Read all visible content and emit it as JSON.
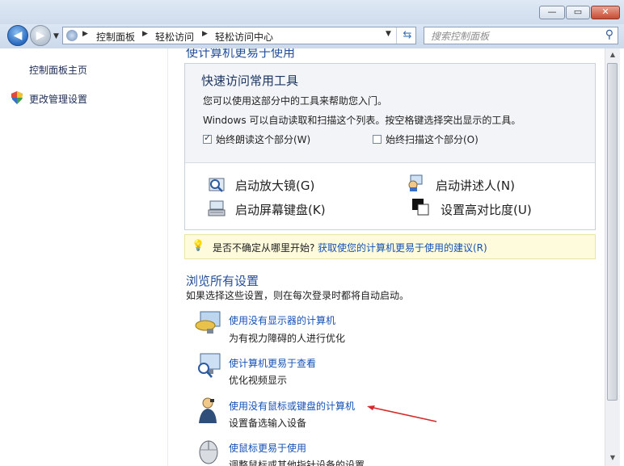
{
  "window_controls": {
    "minimize": "—",
    "maximize": "▭",
    "close": "✕"
  },
  "nav": {
    "breadcrumbs": [
      "控制面板",
      "轻松访问",
      "轻松访问中心"
    ],
    "search_placeholder": "搜索控制面板"
  },
  "sidebar": {
    "links": [
      "控制面板主页",
      "更改管理设置"
    ]
  },
  "main": {
    "cut_heading": "使计算机更易于使用",
    "quick": {
      "title": "快速访问常用工具",
      "desc1": "您可以使用这部分中的工具来帮助您入门。",
      "desc2": "Windows 可以自动读取和扫描这个列表。按空格键选择突出显示的工具。",
      "checkbox_read": "始终朗读这个部分(W)",
      "checkbox_scan": "始终扫描这个部分(O)",
      "checkbox_read_checked": true,
      "checkbox_scan_checked": false,
      "tools": [
        "启动放大镜(G)",
        "启动讲述人(N)",
        "启动屏幕键盘(K)",
        "设置高对比度(U)"
      ]
    },
    "tip": {
      "question": "是否不确定从哪里开始?",
      "link": "获取使您的计算机更易于使用的建议(R)"
    },
    "browse": {
      "title": "浏览所有设置",
      "intro": "如果选择这些设置，则在每次登录时都将自动启动。",
      "items": [
        {
          "link": "使用没有显示器的计算机",
          "desc": "为有视力障碍的人进行优化"
        },
        {
          "link": "使计算机更易于查看",
          "desc": "优化视频显示"
        },
        {
          "link": "使用没有鼠标或键盘的计算机",
          "desc": "设置备选输入设备"
        },
        {
          "link": "使鼠标更易于使用",
          "desc": "调整鼠标或其他指针设备的设置"
        }
      ]
    }
  },
  "colors": {
    "link": "#1651b6",
    "heading": "#244f9a",
    "annotation_arrow": "#d42a2a"
  }
}
